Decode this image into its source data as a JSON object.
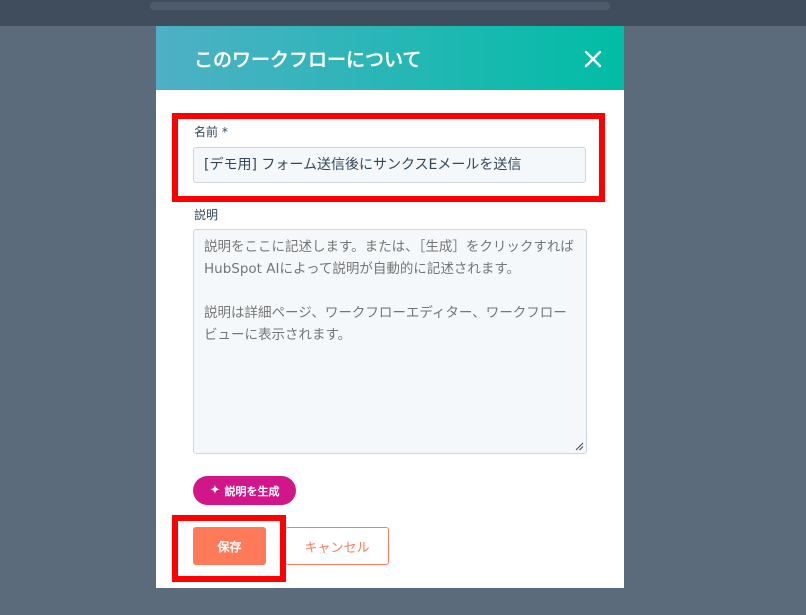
{
  "dialog": {
    "title": "このワークフローについて",
    "close_icon": "close-icon"
  },
  "form": {
    "name": {
      "label": "名前",
      "required_marker": "*",
      "value": "[デモ用] フォーム送信後にサンクスEメールを送信"
    },
    "description": {
      "label": "説明",
      "placeholder": "説明をここに記述します。または、［生成］をクリックすればHubSpot AIによって説明が自動的に記述されます。\n\n説明は詳細ページ、ワークフローエディター、ワークフロービューに表示されます。",
      "value": ""
    }
  },
  "actions": {
    "generate_label": "説明を生成",
    "generate_icon": "sparkle-icon",
    "save_label": "保存",
    "cancel_label": "キャンセル"
  },
  "colors": {
    "header_gradient_start": "#4fb0c6",
    "header_gradient_end": "#00bda5",
    "primary": "#ff7a59",
    "ai_accent": "#d1168a",
    "highlight": "#ff0000",
    "backdrop": "#5b6b7c"
  }
}
